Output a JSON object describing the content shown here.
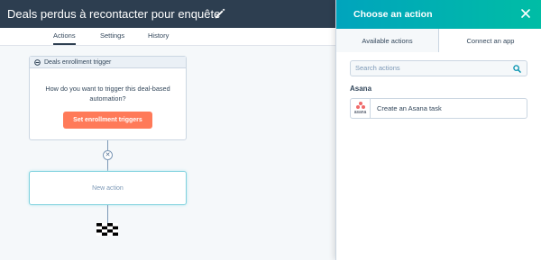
{
  "workflow": {
    "title": "Deals perdus à recontacter pour enquête"
  },
  "tabs": [
    "Actions",
    "Settings",
    "History"
  ],
  "canvas": {
    "trigger_card": {
      "header": "Deals enrollment trigger",
      "question": "How do you want to trigger this deal-based automation?",
      "button_label": "Set enrollment triggers"
    },
    "remove_glyph": "✕",
    "new_action_label": "New action"
  },
  "panel": {
    "title": "Choose an action",
    "tabs": {
      "available": "Available actions",
      "connect": "Connect an app"
    },
    "search_placeholder": "Search actions",
    "section_title": "Asana",
    "action": {
      "logo_text": "asana",
      "label": "Create an Asana task"
    }
  },
  "colors": {
    "topbar": "#2d3e50",
    "panel_header_from": "#00a4bd",
    "panel_header_to": "#00bda5",
    "primary_button": "#ff7a59",
    "asana_brand": "#f06a6a"
  },
  "icons": [
    "pencil-icon",
    "enrollment-icon",
    "close-icon",
    "search-icon",
    "finish-flag-icon",
    "asana-logo"
  ]
}
